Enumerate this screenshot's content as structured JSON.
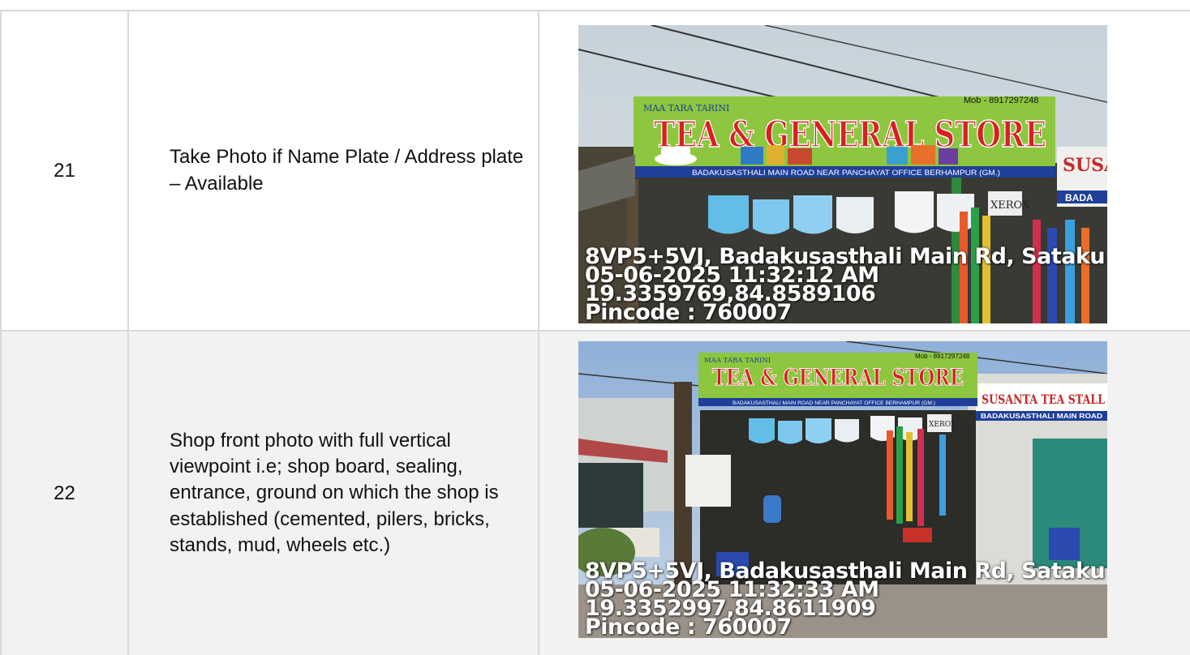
{
  "rows": [
    {
      "number": "21",
      "description": "Take Photo if Name Plate / Address plate – Available",
      "photo": {
        "sign_top_left": "MAA TARA TARINI",
        "sign_mobile": "Mob - 8917297248",
        "sign_title": "TEA & GENERAL STORE",
        "sign_address": "BADAKUSASTHALI MAIN ROAD NEAR PANCHAYAT OFFICE BERHAMPUR (GM.)",
        "side_sign": "SUSA",
        "side_sign_sub": "BADA",
        "xerox_label": "XEROX",
        "stamp_address": "8VP5+5VJ, Badakusasthali Main Rd, Sataku",
        "stamp_datetime": "05-06-2025 11:32:12 AM",
        "stamp_coords": "19.3359769,84.8589106",
        "stamp_pincode": "Pincode : 760007"
      }
    },
    {
      "number": "22",
      "description": "Shop front photo with full vertical viewpoint i.e; shop board, sealing, entrance, ground on which the shop is established (cemented, pilers, bricks, stands, mud, wheels etc.)",
      "photo": {
        "sign_top_left": "MAA TARA TARINI",
        "sign_mobile": "Mob - 8917297248",
        "sign_title": "TEA & GENERAL STORE",
        "sign_address": "BADAKUSASTHALI MAIN ROAD NEAR PANCHAYAT OFFICE BERHAMPUR (GM.)",
        "side_sign": "SUSANTA TEA STALL",
        "side_sign_sub": "BADAKUSASTHALI MAIN ROAD",
        "xerox_label": "XEROX",
        "stamp_address": "8VP5+5VJ, Badakusasthali Main Rd, Sataku",
        "stamp_datetime": "05-06-2025 11:32:33 AM",
        "stamp_coords": "19.3352997,84.8611909",
        "stamp_pincode": "Pincode : 760007"
      }
    }
  ],
  "colors": {
    "border": "#d9d9d9",
    "row_alt_background": "#f2f2f2",
    "sign_green": "#8dc63f",
    "sign_red": "#d9201f",
    "sign_blue_strip": "#1f3f99"
  }
}
